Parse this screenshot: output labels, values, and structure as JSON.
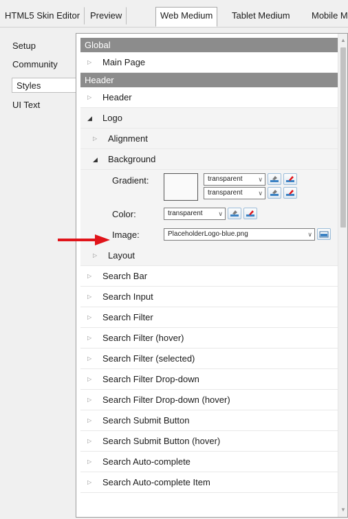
{
  "tabs": [
    {
      "label": "HTML5 Skin Editor",
      "active": false
    },
    {
      "label": "Preview",
      "active": false
    },
    {
      "label": "Web Medium",
      "active": true
    },
    {
      "label": "Tablet Medium",
      "active": false
    },
    {
      "label": "Mobile M",
      "active": false
    }
  ],
  "left_nav": [
    {
      "label": "Setup"
    },
    {
      "label": "Community"
    },
    {
      "label": "Styles",
      "selected": true
    },
    {
      "label": "UI Text"
    }
  ],
  "sections": {
    "global": {
      "label": "Global",
      "items": [
        {
          "label": "Main Page"
        }
      ]
    },
    "header": {
      "label": "Header",
      "items": [
        {
          "label": "Header"
        },
        {
          "label": "Logo"
        },
        {
          "label": "Alignment"
        },
        {
          "label": "Background"
        },
        {
          "label": "Layout"
        },
        {
          "label": "Search Bar"
        },
        {
          "label": "Search Input"
        },
        {
          "label": "Search Filter"
        },
        {
          "label": "Search Filter (hover)"
        },
        {
          "label": "Search Filter (selected)"
        },
        {
          "label": "Search Filter Drop-down"
        },
        {
          "label": "Search Filter Drop-down (hover)"
        },
        {
          "label": "Search Submit Button"
        },
        {
          "label": "Search Submit Button (hover)"
        },
        {
          "label": "Search Auto-complete"
        },
        {
          "label": "Search Auto-complete Item"
        }
      ]
    }
  },
  "background": {
    "gradient_label": "Gradient:",
    "gradient_value_1": "transparent",
    "gradient_value_2": "transparent",
    "color_label": "Color:",
    "color_value": "transparent",
    "image_label": "Image:",
    "image_value": "PlaceholderLogo-blue.png"
  },
  "colors": {
    "section_header_bg": "#8c8c8c",
    "annotation_arrow": "#e0141a"
  },
  "icons": {
    "collapsed": "triangle-right-icon",
    "expanded": "triangle-down-icon",
    "color_picker": "color-picker-icon",
    "clear_color": "clear-color-icon",
    "browse_image": "browse-image-icon"
  }
}
